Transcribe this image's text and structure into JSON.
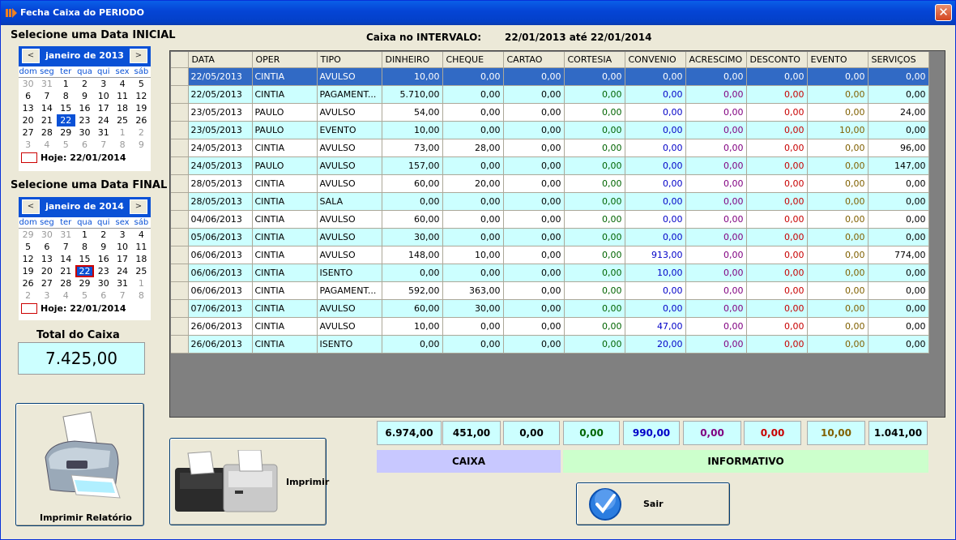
{
  "window": {
    "title": "Fecha Caixa do PERIODO",
    "close_label": "✕"
  },
  "start": {
    "label": "Selecione uma Data INICIAL",
    "month": "janeiro de 2013",
    "prev": "<",
    "next": ">",
    "dow": [
      "dom",
      "seg",
      "ter",
      "qua",
      "qui",
      "sex",
      "sáb"
    ],
    "days": [
      "30",
      "31",
      "1",
      "2",
      "3",
      "4",
      "5",
      "6",
      "7",
      "8",
      "9",
      "10",
      "11",
      "12",
      "13",
      "14",
      "15",
      "16",
      "17",
      "18",
      "19",
      "20",
      "21",
      "22",
      "23",
      "24",
      "25",
      "26",
      "27",
      "28",
      "29",
      "30",
      "31",
      "1",
      "2",
      "3",
      "4",
      "5",
      "6",
      "7",
      "8",
      "9"
    ],
    "today": "Hoje: 22/01/2014"
  },
  "end": {
    "label": "Selecione uma Data FINAL",
    "month": "janeiro de 2014",
    "prev": "<",
    "next": ">",
    "dow": [
      "dom",
      "seg",
      "ter",
      "qua",
      "qui",
      "sex",
      "sáb"
    ],
    "days": [
      "29",
      "30",
      "31",
      "1",
      "2",
      "3",
      "4",
      "5",
      "6",
      "7",
      "8",
      "9",
      "10",
      "11",
      "12",
      "13",
      "14",
      "15",
      "16",
      "17",
      "18",
      "19",
      "20",
      "21",
      "22",
      "23",
      "24",
      "25",
      "26",
      "27",
      "28",
      "29",
      "30",
      "31",
      "1",
      "2",
      "3",
      "4",
      "5",
      "6",
      "7",
      "8"
    ],
    "today": "Hoje: 22/01/2014"
  },
  "total": {
    "label": "Total do Caixa",
    "value": "7.425,00"
  },
  "interval": {
    "label": "Caixa no INTERVALO:",
    "value": "22/01/2013 até 22/01/2014"
  },
  "columns": [
    "DATA",
    "OPER",
    "TIPO",
    "DINHEIRO",
    "CHEQUE",
    "CARTAO",
    "CORTESIA",
    "CONVENIO",
    "ACRESCIMO",
    "DESCONTO",
    "EVENTO",
    "SERVIÇOS"
  ],
  "rows": [
    [
      "22/05/2013",
      "CINTIA",
      "AVULSO",
      "10,00",
      "0,00",
      "0,00",
      "0,00",
      "0,00",
      "0,00",
      "0,00",
      "0,00",
      "0,00"
    ],
    [
      "22/05/2013",
      "CINTIA",
      "PAGAMENT...",
      "5.710,00",
      "0,00",
      "0,00",
      "0,00",
      "0,00",
      "0,00",
      "0,00",
      "0,00",
      "0,00"
    ],
    [
      "23/05/2013",
      "PAULO",
      "AVULSO",
      "54,00",
      "0,00",
      "0,00",
      "0,00",
      "0,00",
      "0,00",
      "0,00",
      "0,00",
      "24,00"
    ],
    [
      "23/05/2013",
      "PAULO",
      "EVENTO",
      "10,00",
      "0,00",
      "0,00",
      "0,00",
      "0,00",
      "0,00",
      "0,00",
      "10,00",
      "0,00"
    ],
    [
      "24/05/2013",
      "CINTIA",
      "AVULSO",
      "73,00",
      "28,00",
      "0,00",
      "0,00",
      "0,00",
      "0,00",
      "0,00",
      "0,00",
      "96,00"
    ],
    [
      "24/05/2013",
      "PAULO",
      "AVULSO",
      "157,00",
      "0,00",
      "0,00",
      "0,00",
      "0,00",
      "0,00",
      "0,00",
      "0,00",
      "147,00"
    ],
    [
      "28/05/2013",
      "CINTIA",
      "AVULSO",
      "60,00",
      "20,00",
      "0,00",
      "0,00",
      "0,00",
      "0,00",
      "0,00",
      "0,00",
      "0,00"
    ],
    [
      "28/05/2013",
      "CINTIA",
      "SALA",
      "0,00",
      "0,00",
      "0,00",
      "0,00",
      "0,00",
      "0,00",
      "0,00",
      "0,00",
      "0,00"
    ],
    [
      "04/06/2013",
      "CINTIA",
      "AVULSO",
      "60,00",
      "0,00",
      "0,00",
      "0,00",
      "0,00",
      "0,00",
      "0,00",
      "0,00",
      "0,00"
    ],
    [
      "05/06/2013",
      "CINTIA",
      "AVULSO",
      "30,00",
      "0,00",
      "0,00",
      "0,00",
      "0,00",
      "0,00",
      "0,00",
      "0,00",
      "0,00"
    ],
    [
      "06/06/2013",
      "CINTIA",
      "AVULSO",
      "148,00",
      "10,00",
      "0,00",
      "0,00",
      "913,00",
      "0,00",
      "0,00",
      "0,00",
      "774,00"
    ],
    [
      "06/06/2013",
      "CINTIA",
      "ISENTO",
      "0,00",
      "0,00",
      "0,00",
      "0,00",
      "10,00",
      "0,00",
      "0,00",
      "0,00",
      "0,00"
    ],
    [
      "06/06/2013",
      "CINTIA",
      "PAGAMENT...",
      "592,00",
      "363,00",
      "0,00",
      "0,00",
      "0,00",
      "0,00",
      "0,00",
      "0,00",
      "0,00"
    ],
    [
      "07/06/2013",
      "CINTIA",
      "AVULSO",
      "60,00",
      "30,00",
      "0,00",
      "0,00",
      "0,00",
      "0,00",
      "0,00",
      "0,00",
      "0,00"
    ],
    [
      "26/06/2013",
      "CINTIA",
      "AVULSO",
      "10,00",
      "0,00",
      "0,00",
      "0,00",
      "47,00",
      "0,00",
      "0,00",
      "0,00",
      "0,00"
    ],
    [
      "26/06/2013",
      "CINTIA",
      "ISENTO",
      "0,00",
      "0,00",
      "0,00",
      "0,00",
      "20,00",
      "0,00",
      "0,00",
      "0,00",
      "0,00"
    ]
  ],
  "totals": [
    "6.974,00",
    "451,00",
    "0,00",
    "0,00",
    "990,00",
    "0,00",
    "0,00",
    "10,00",
    "1.041,00"
  ],
  "bands": {
    "caixa": "CAIXA",
    "informativo": "INFORMATIVO"
  },
  "buttons": {
    "print_report": "Imprimir Relatório",
    "print": "Imprimir",
    "exit": "Sair"
  },
  "colors": {
    "selected_row": "#316ac5",
    "alt_row": "#ccffff",
    "caixa_band": "#c8c8ff",
    "info_band": "#ccffcc"
  }
}
